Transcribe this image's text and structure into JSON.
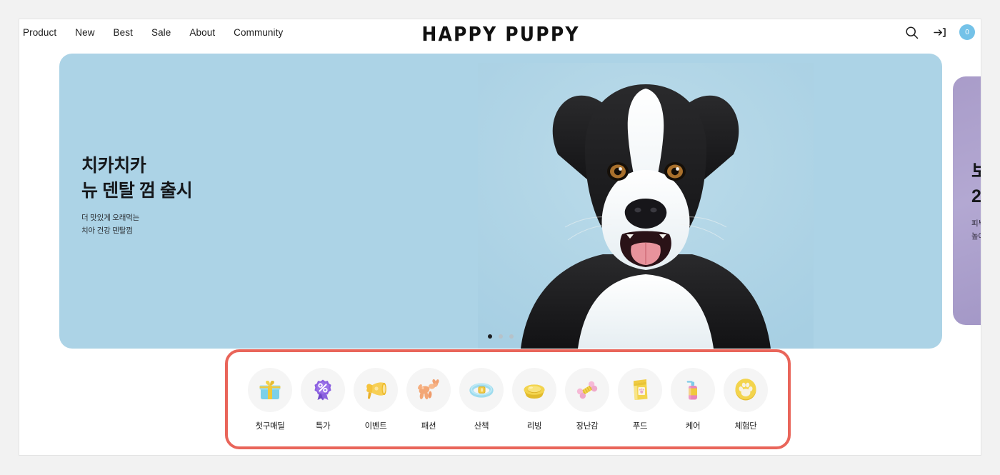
{
  "header": {
    "nav": [
      {
        "label": "Product",
        "name": "nav-product"
      },
      {
        "label": "New",
        "name": "nav-new"
      },
      {
        "label": "Best",
        "name": "nav-best"
      },
      {
        "label": "Sale",
        "name": "nav-sale"
      },
      {
        "label": "About",
        "name": "nav-about"
      },
      {
        "label": "Community",
        "name": "nav-community"
      }
    ],
    "logo": "HAPPY PUPPY",
    "actions": {
      "search_icon": "search-icon",
      "login_icon": "login-icon",
      "cart_count": "0"
    },
    "colors": {
      "cart_badge": "#74c2e8",
      "text": "#1c1c1c"
    }
  },
  "hero": {
    "slides": [
      {
        "title_line1": "치카치카",
        "title_line2": "뉴 덴탈 껌 출시",
        "sub_line1": "더 맛있게 오래먹는",
        "sub_line2": "치아 건강 덴탈껌",
        "background": "#acd3e6",
        "image": "border-collie-photo"
      },
      {
        "title_line1": "보",
        "title_line2": "2",
        "sub_line1": "피부",
        "sub_line2": "높여",
        "background": "#a99cc9"
      }
    ],
    "dots": {
      "total": 3,
      "active_index": 0
    }
  },
  "categories": {
    "highlight_color": "#e9655a",
    "items": [
      {
        "label": "첫구매딜",
        "icon": "gift-icon"
      },
      {
        "label": "특가",
        "icon": "discount-badge-icon"
      },
      {
        "label": "이벤트",
        "icon": "megaphone-icon"
      },
      {
        "label": "패션",
        "icon": "balloon-dog-icon"
      },
      {
        "label": "산책",
        "icon": "collar-icon"
      },
      {
        "label": "리빙",
        "icon": "bowl-icon"
      },
      {
        "label": "장난감",
        "icon": "chew-toy-icon"
      },
      {
        "label": "푸드",
        "icon": "food-bag-icon"
      },
      {
        "label": "케어",
        "icon": "pump-bottle-icon"
      },
      {
        "label": "체험단",
        "icon": "paw-print-icon"
      }
    ]
  }
}
